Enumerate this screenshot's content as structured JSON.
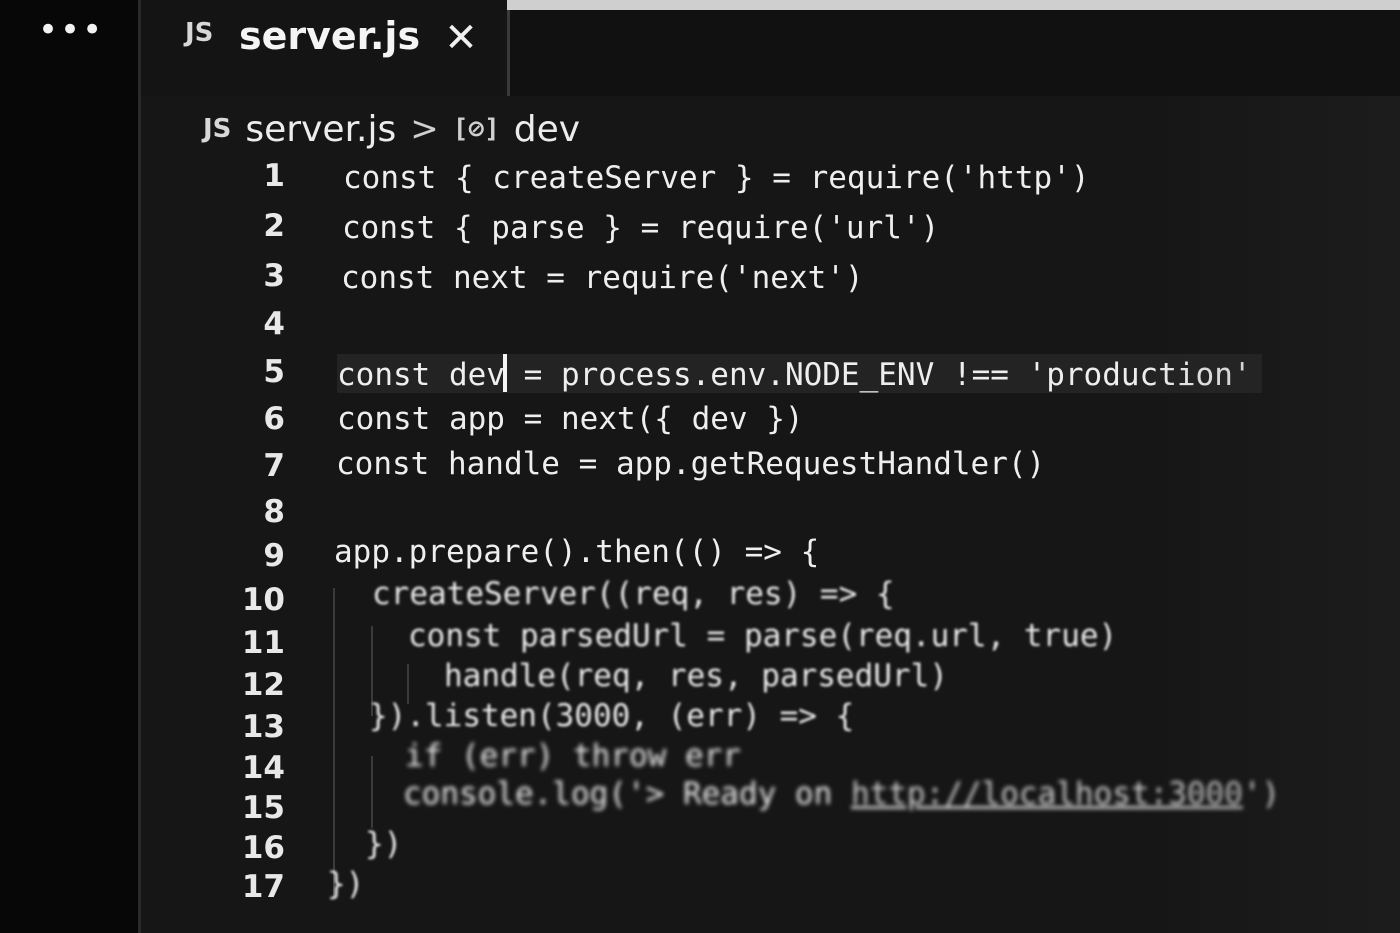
{
  "activity_bar": {
    "more_label": "•••"
  },
  "tabs": [
    {
      "icon": "js-file-icon",
      "icon_text": "JS",
      "label": "server.js",
      "close_glyph": "✕"
    }
  ],
  "breadcrumb": {
    "file_icon_text": "JS",
    "file": "server.js",
    "separator": ">",
    "symbol_icon_text": "[⊘]",
    "symbol": "dev"
  },
  "editor": {
    "line_numbers": [
      "1",
      "2",
      "3",
      "4",
      "5",
      "6",
      "7",
      "8",
      "9",
      "10",
      "11",
      "12",
      "13",
      "14",
      "15",
      "16",
      "17"
    ],
    "lines": [
      "const { createServer } = require('http')",
      "const { parse } = require('url')",
      "const next = require('next')",
      "",
      "const dev = process.env.NODE_ENV !== 'production'",
      "const app = next({ dev })",
      "const handle = app.getRequestHandler()",
      "",
      "app.prepare().then(() => {",
      "createServer((req, res) => {",
      "const parsedUrl = parse(req.url, true)",
      "handle(req, res, parsedUrl)",
      "}).listen(3000, (err) => {",
      "if (err) throw err",
      "console.log('> Ready on ",
      "})",
      "})"
    ],
    "line5_before_caret": "const dev",
    "line5_after_caret": " = process.env.NODE_ENV !== 'production'",
    "line15_link": "http://localhost:3000",
    "line15_tail": "')"
  },
  "colors": {
    "background": "#161616",
    "text": "#eeeeee",
    "current_line": "#232323"
  }
}
